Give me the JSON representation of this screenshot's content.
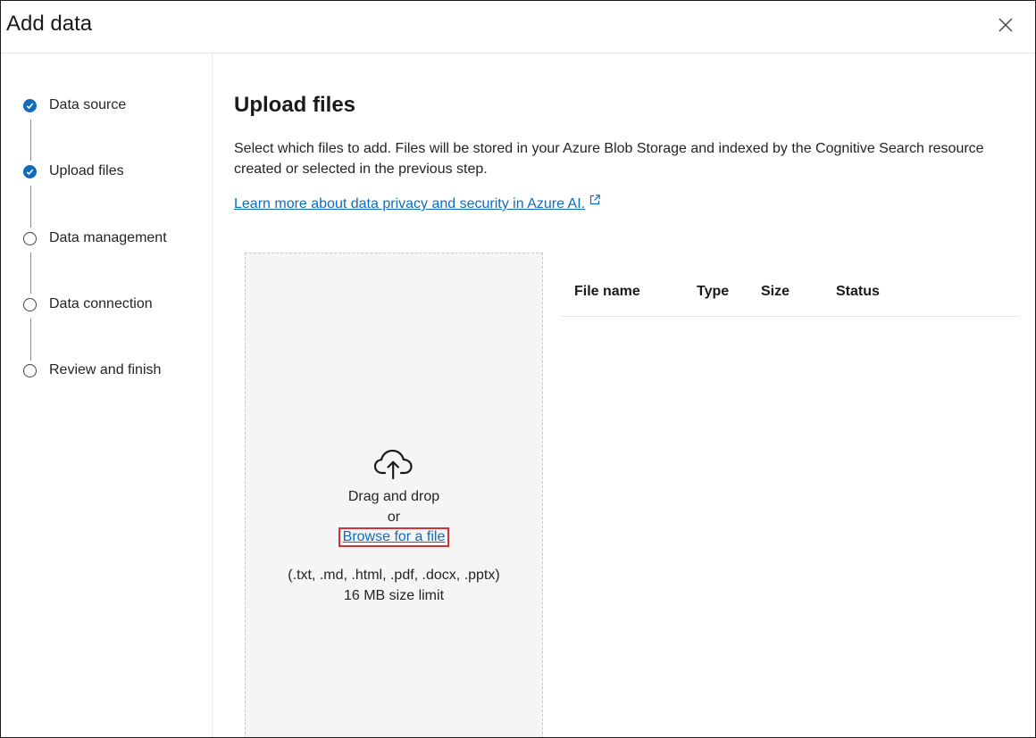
{
  "dialog": {
    "title": "Add data",
    "close_icon": "close-icon"
  },
  "stepper": {
    "steps": [
      {
        "label": "Data source",
        "status": "completed"
      },
      {
        "label": "Upload files",
        "status": "completed"
      },
      {
        "label": "Data management",
        "status": "pending"
      },
      {
        "label": "Data connection",
        "status": "pending"
      },
      {
        "label": "Review and finish",
        "status": "pending"
      }
    ]
  },
  "main": {
    "title": "Upload files",
    "description": "Select which files to add. Files will be stored in your Azure Blob Storage and indexed by the Cognitive Search resource created or selected in the previous step.",
    "privacy_link": "Learn more about data privacy and security in Azure AI."
  },
  "dropzone": {
    "icon": "cloud-upload-icon",
    "drag_text": "Drag and drop",
    "or_text": "or",
    "browse_link": "Browse for a file",
    "file_types": "(.txt, .md, .html, .pdf, .docx, .pptx)",
    "size_limit": "16 MB size limit"
  },
  "files_table": {
    "columns": [
      "File name",
      "Type",
      "Size",
      "Status"
    ],
    "rows": []
  },
  "colors": {
    "accent": "#0f6cbd",
    "highlight_border": "#d13438",
    "dropzone_bg": "#f5f5f5"
  }
}
